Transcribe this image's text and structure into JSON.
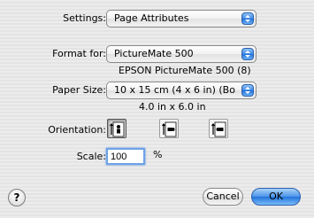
{
  "settings": {
    "label": "Settings:",
    "value": "Page Attributes"
  },
  "format_for": {
    "label": "Format for:",
    "value": "PictureMate 500",
    "printer_description": "EPSON PictureMate 500 (8)"
  },
  "paper_size": {
    "label": "Paper Size:",
    "value": "10 x 15 cm (4 x 6 in) (Bo...",
    "dimensions": "4.0 in x 6.0 in"
  },
  "orientation": {
    "label": "Orientation:",
    "options": [
      {
        "name": "portrait",
        "selected": true
      },
      {
        "name": "landscape",
        "selected": false
      },
      {
        "name": "reverse-landscape",
        "selected": false
      }
    ]
  },
  "scale": {
    "label": "Scale:",
    "value": "100",
    "unit": "%"
  },
  "buttons": {
    "help": "?",
    "cancel": "Cancel",
    "ok": "OK"
  },
  "colors": {
    "accent": "#3f8ae6",
    "focus_ring": "#6ea3e8"
  }
}
